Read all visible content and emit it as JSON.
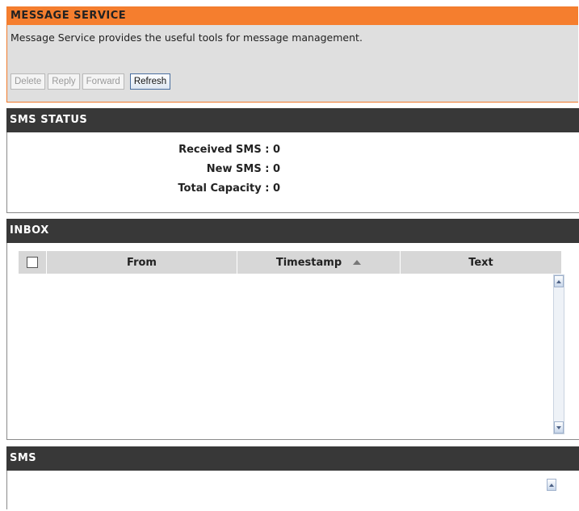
{
  "message_service": {
    "title": "MESSAGE SERVICE",
    "description": "Message Service provides the useful tools for message management.",
    "buttons": {
      "delete": "Delete",
      "reply": "Reply",
      "forward": "Forward",
      "refresh": "Refresh"
    }
  },
  "sms_status": {
    "title": "SMS STATUS",
    "received": "Received SMS : 0",
    "new": "New SMS : 0",
    "capacity": "Total Capacity : 0"
  },
  "inbox": {
    "title": "INBOX",
    "columns": [
      "From",
      "Timestamp",
      "Text"
    ],
    "rows": []
  },
  "sms": {
    "title": "SMS"
  },
  "colors": {
    "accent_orange": "#f57e2e",
    "section_header": "#383838",
    "table_header": "#d7d7d7"
  }
}
